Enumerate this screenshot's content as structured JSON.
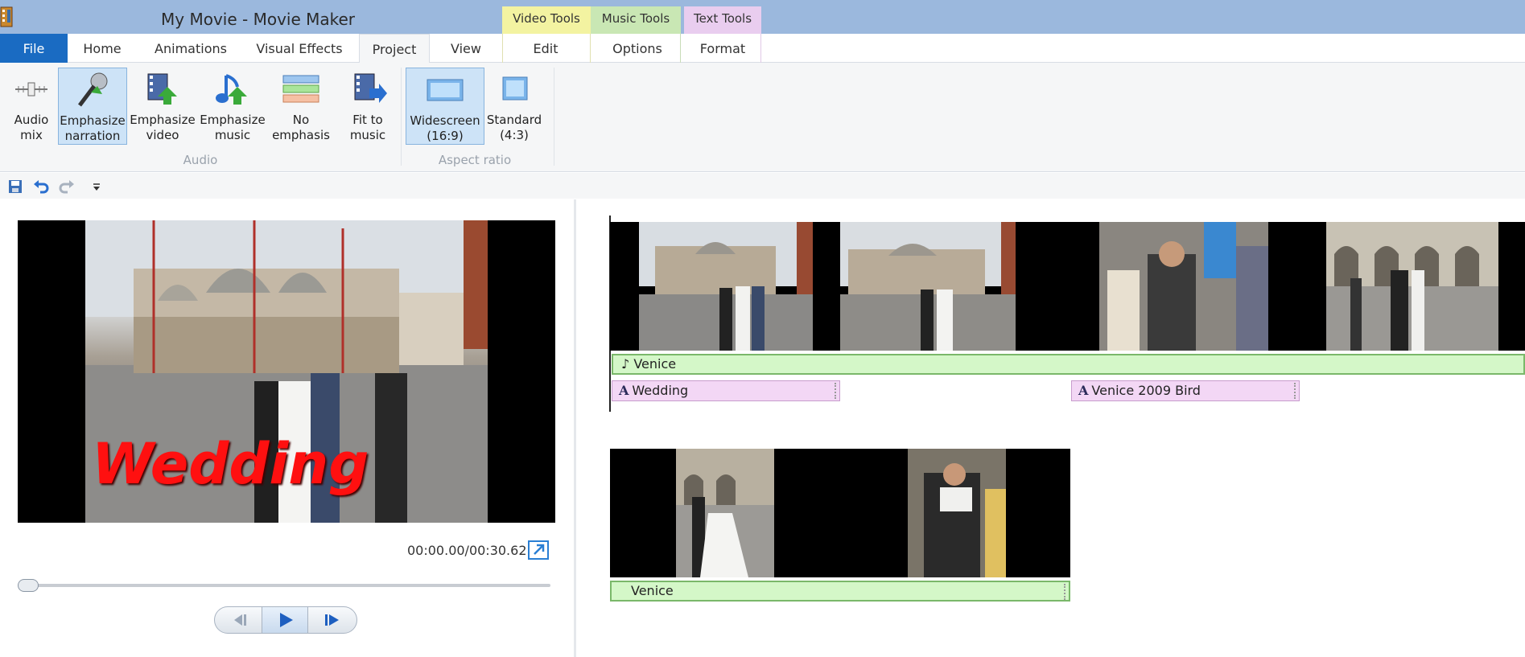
{
  "window": {
    "title": "My Movie - Movie Maker",
    "context_tabs": [
      "Video Tools",
      "Music Tools",
      "Text Tools"
    ]
  },
  "tabs": [
    "File",
    "Home",
    "Animations",
    "Visual Effects",
    "Project",
    "View",
    "Edit",
    "Options",
    "Format"
  ],
  "ribbon": {
    "audio_group": {
      "label": "Audio",
      "buttons": [
        {
          "l1": "Audio",
          "l2": "mix"
        },
        {
          "l1": "Emphasize",
          "l2": "narration"
        },
        {
          "l1": "Emphasize",
          "l2": "video"
        },
        {
          "l1": "Emphasize",
          "l2": "music"
        },
        {
          "l1": "No",
          "l2": "emphasis"
        },
        {
          "l1": "Fit to",
          "l2": "music"
        }
      ]
    },
    "aspect_group": {
      "label": "Aspect ratio",
      "buttons": [
        {
          "l1": "Widescreen",
          "l2": "(16:9)"
        },
        {
          "l1": "Standard",
          "l2": "(4:3)"
        }
      ]
    }
  },
  "preview": {
    "caption": "Wedding",
    "timecode": "00:00.00/00:30.62",
    "seek_progress": 0
  },
  "storyboard": {
    "music_label": "Venice",
    "text_items": [
      "Wedding",
      "Venice 2009 Bird"
    ],
    "second_music_label": "Venice"
  },
  "colors": {
    "title_bar": "#9bb8dd",
    "file_tab": "#1a6bc2",
    "video_tools": "#f3f3a1",
    "music_tools": "#c9e7b4",
    "text_tools": "#e9cdef",
    "music_track": "#d4f7c8",
    "text_track": "#f3d7f5",
    "caption": "#ff1010"
  }
}
